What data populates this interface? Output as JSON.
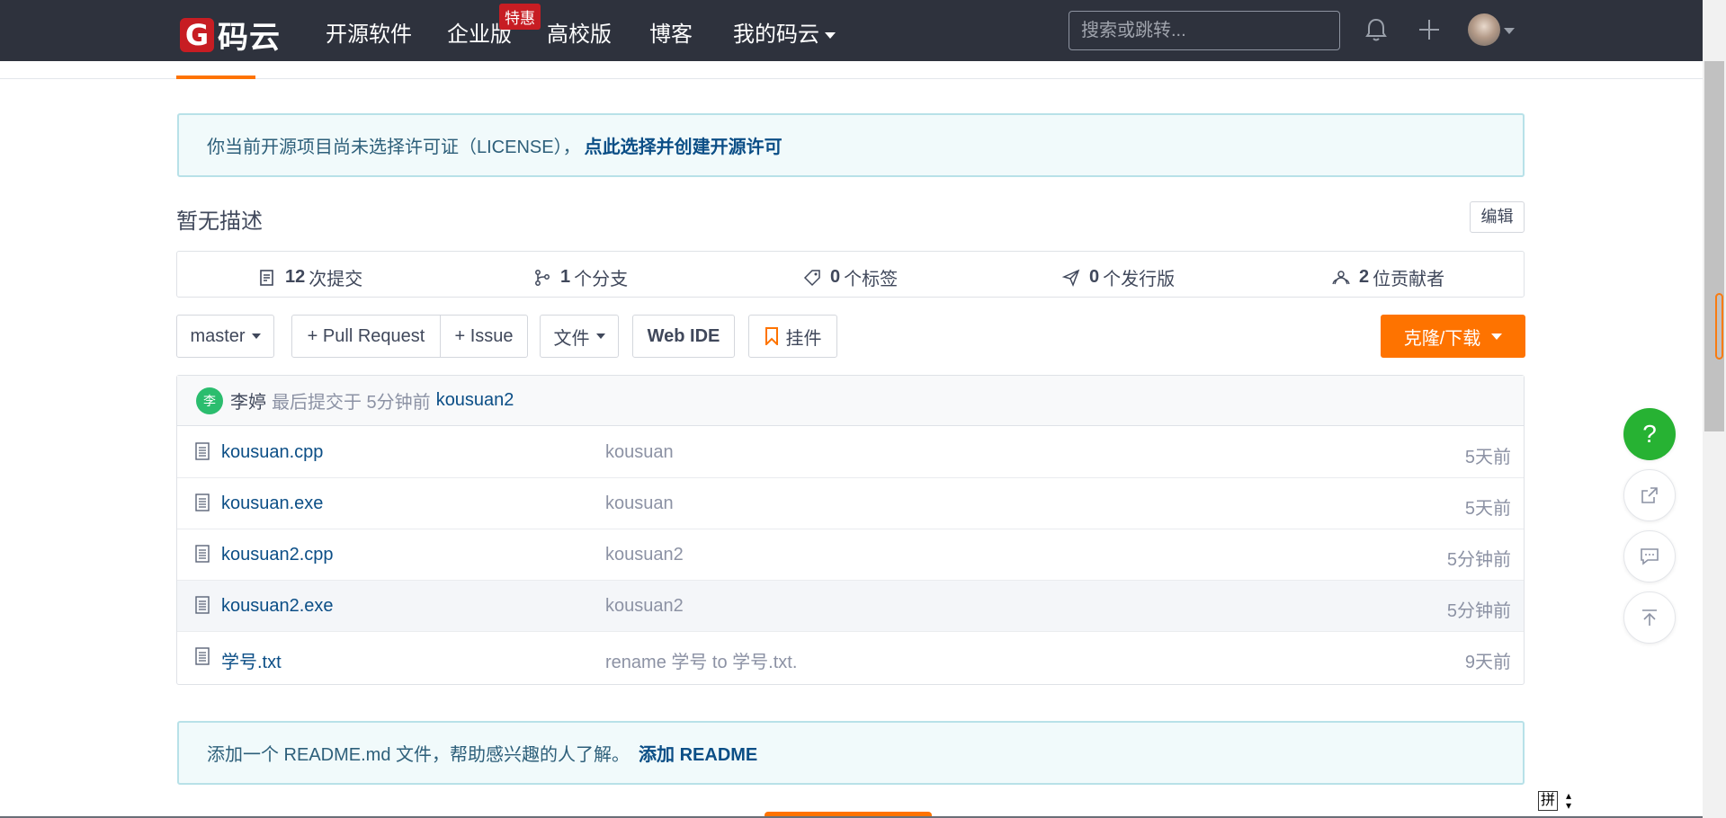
{
  "navbar": {
    "logo_mark": "G",
    "logo_text": "码云",
    "items": [
      "开源软件",
      "企业版",
      "高校版",
      "博客",
      "我的码云"
    ],
    "promo_badge": "特惠",
    "search_placeholder": "搜索或跳转...",
    "icons": [
      "bell-icon",
      "plus-icon",
      "user-avatar",
      "chevron-down-icon"
    ]
  },
  "license_alert": {
    "text": "你当前开源项目尚未选择许可证（LICENSE），",
    "link": "点此选择并创建开源许可"
  },
  "description": {
    "text": "暂无描述",
    "edit_label": "编辑"
  },
  "stats": [
    {
      "count": "12",
      "label": "次提交",
      "icon": "commit-icon"
    },
    {
      "count": "1",
      "label": "个分支",
      "icon": "branch-icon"
    },
    {
      "count": "0",
      "label": "个标签",
      "icon": "tag-icon"
    },
    {
      "count": "0",
      "label": "个发行版",
      "icon": "release-icon"
    },
    {
      "count": "2",
      "label": "位贡献者",
      "icon": "contributors-icon"
    }
  ],
  "toolbar": {
    "branch": "master",
    "pull_request": "+ Pull Request",
    "issue": "+ Issue",
    "file": "文件",
    "web_ide": "Web IDE",
    "widget": "挂件",
    "clone": "克隆/下载"
  },
  "last_commit": {
    "avatar_initial": "李",
    "author": "李婷",
    "text": "最后提交于 5分钟前",
    "message": "kousuan2"
  },
  "files": [
    {
      "name": "kousuan.cpp",
      "message": "kousuan",
      "time": "5天前"
    },
    {
      "name": "kousuan.exe",
      "message": "kousuan",
      "time": "5天前"
    },
    {
      "name": "kousuan2.cpp",
      "message": "kousuan2",
      "time": "5分钟前"
    },
    {
      "name": "kousuan2.exe",
      "message": "kousuan2",
      "time": "5分钟前"
    },
    {
      "name": "学号.txt",
      "message": "rename 学号 to 学号.txt.",
      "time": "9天前"
    }
  ],
  "readme_alert": {
    "text": "添加一个 README.md 文件，帮助感兴趣的人了解。",
    "link": "添加 README"
  },
  "float_buttons": {
    "help": "?"
  },
  "ime": {
    "label": "拼"
  },
  "colors": {
    "navbar_bg": "#2e323d",
    "accent_orange": "#fe7300",
    "brand_red": "#c71d23",
    "link_blue": "#0b4e86",
    "help_green": "#27b233"
  }
}
